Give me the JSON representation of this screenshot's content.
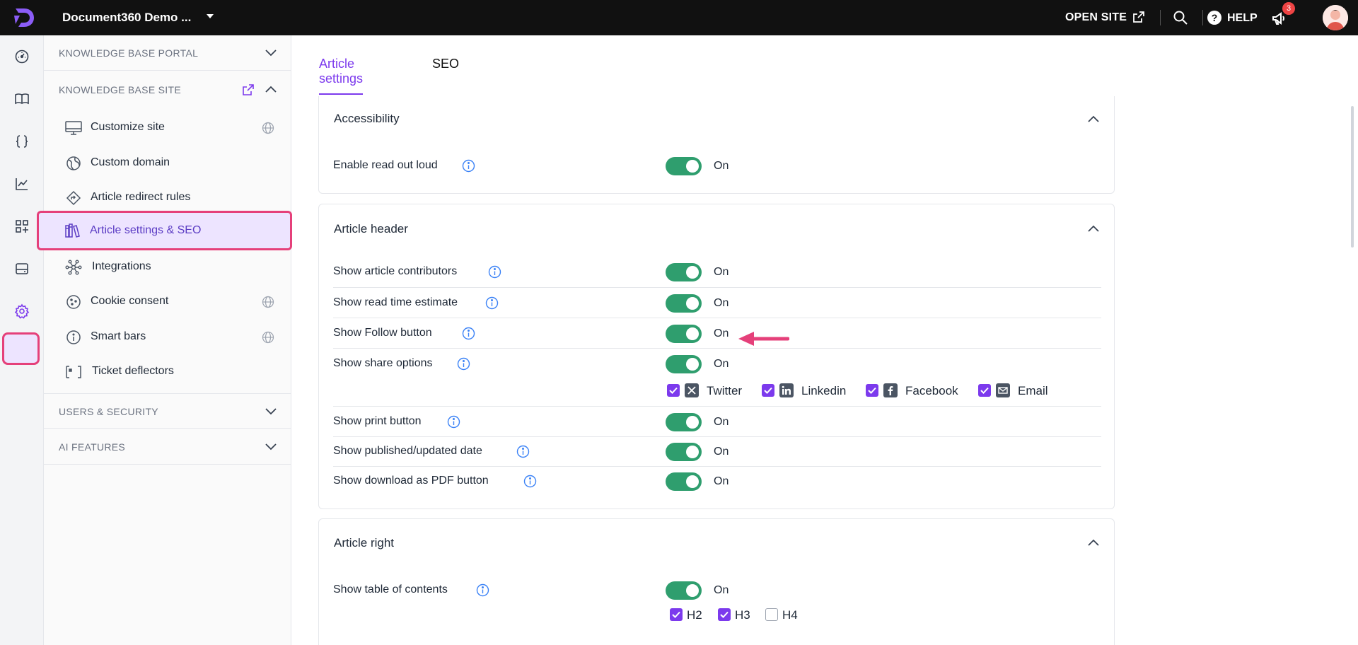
{
  "topbar": {
    "project_name": "Document360 Demo ...",
    "open_site_label": "OPEN SITE",
    "help_label": "HELP",
    "notification_count": "3"
  },
  "sidenav": {
    "sections": [
      {
        "label": "KNOWLEDGE BASE PORTAL",
        "expanded": false
      },
      {
        "label": "KNOWLEDGE BASE SITE",
        "expanded": true
      },
      {
        "label": "USERS & SECURITY",
        "expanded": false
      },
      {
        "label": "AI FEATURES",
        "expanded": false
      }
    ],
    "items": [
      {
        "label": "Customize site",
        "icon": "monitor-icon"
      },
      {
        "label": "Custom domain",
        "icon": "domain-icon"
      },
      {
        "label": "Article redirect rules",
        "icon": "redirect-icon"
      },
      {
        "label": "Article settings & SEO",
        "icon": "books-icon",
        "active": true
      },
      {
        "label": "Integrations",
        "icon": "integrations-icon"
      },
      {
        "label": "Cookie consent",
        "icon": "cookie-icon"
      },
      {
        "label": "Smart bars",
        "icon": "info-circle-icon"
      },
      {
        "label": "Ticket deflectors",
        "icon": "ticket-icon"
      }
    ]
  },
  "tabs": {
    "article_settings": "Article settings",
    "seo": "SEO"
  },
  "accessibility": {
    "title": "Accessibility",
    "rows": [
      {
        "label": "Enable read out loud",
        "state": "On"
      }
    ]
  },
  "article_header": {
    "title": "Article header",
    "rows": [
      {
        "label": "Show article contributors",
        "state": "On"
      },
      {
        "label": "Show read time estimate",
        "state": "On"
      },
      {
        "label": "Show Follow button",
        "state": "On"
      },
      {
        "label": "Show share options",
        "state": "On"
      },
      {
        "label": "Show print button",
        "state": "On"
      },
      {
        "label": "Show published/updated date",
        "state": "On"
      },
      {
        "label": "Show download as PDF button",
        "state": "On"
      }
    ],
    "share_options": [
      {
        "label": "Twitter",
        "checked": true
      },
      {
        "label": "Linkedin",
        "checked": true
      },
      {
        "label": "Facebook",
        "checked": true
      },
      {
        "label": "Email",
        "checked": true
      }
    ]
  },
  "article_right": {
    "title": "Article right",
    "rows": [
      {
        "label": "Show table of contents",
        "state": "On"
      }
    ],
    "toc_levels": [
      {
        "label": "H2",
        "checked": true
      },
      {
        "label": "H3",
        "checked": true
      },
      {
        "label": "H4",
        "checked": false
      }
    ]
  },
  "colors": {
    "accent": "#7c3aed",
    "toggle_on": "#2f9e6e",
    "highlight": "#e5407a"
  }
}
